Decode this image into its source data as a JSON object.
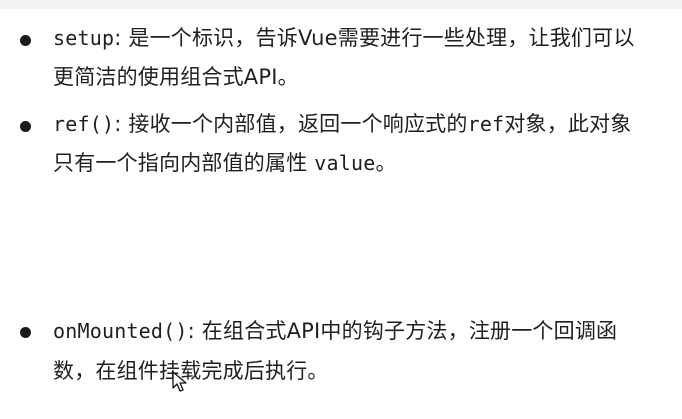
{
  "items": [
    {
      "code": "setup",
      "line1_text": ": 是一个标识，告诉Vue需要进行一些处理，让我们可以",
      "line2_text": "更简洁的使用组合式API。"
    },
    {
      "code": "ref()",
      "line1_text": ": 接收一个内部值，返回一个响应式的",
      "line1_code2": "ref",
      "line1_text2": "对象，此对象",
      "line2_text": "只有一个指向内部值的属性 ",
      "line2_code": "value",
      "line2_text2": "。"
    },
    {
      "code": "onMounted()",
      "line1_text": ": 在组合式API中的钩子方法，注册一个回调函",
      "line2_text": "数，在组件挂载完成后执行。"
    }
  ],
  "icons": {
    "bullet": "bullet-dot",
    "cursor": "mouse-pointer-icon"
  }
}
